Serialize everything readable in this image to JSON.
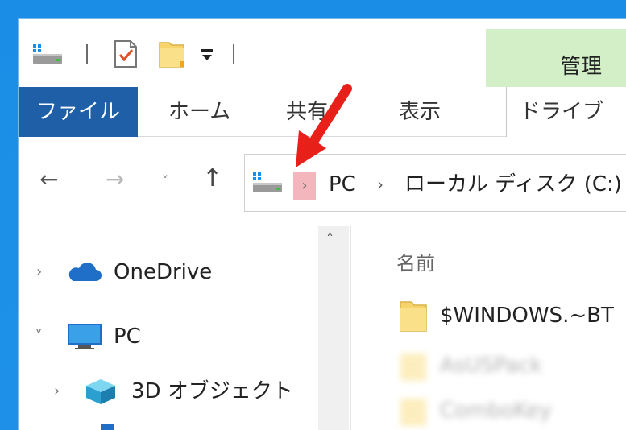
{
  "ribbon": {
    "tabs": {
      "file": "ファイル",
      "home": "ホーム",
      "share": "共有",
      "view": "表示",
      "drive_tools": "ドライブ ツー"
    },
    "contextual_group": "管理"
  },
  "quick_access": {
    "icons": [
      "drive-icon",
      "properties-icon",
      "new-folder-icon",
      "customize-dropdown-icon"
    ]
  },
  "address_bar": {
    "root_chevron": "›",
    "segments": [
      "PC",
      "ローカル ディスク (C:)"
    ],
    "separator": "›"
  },
  "nav_buttons": {
    "back": "←",
    "forward": "→",
    "recent": "˅",
    "up": "↑"
  },
  "nav_pane": {
    "items": [
      {
        "label": "OneDrive",
        "chevron": "›",
        "icon": "cloud-icon"
      },
      {
        "label": "PC",
        "chevron": "˅",
        "icon": "monitor-icon"
      },
      {
        "label": "3D オブジェクト",
        "chevron": "›",
        "icon": "cube-icon"
      }
    ],
    "scroll_up": "˄"
  },
  "file_list": {
    "column_header": "名前",
    "items": [
      {
        "name": "$WINDOWS.~BT"
      },
      {
        "name": "AsUSPack"
      },
      {
        "name": "ComboKey"
      }
    ]
  },
  "colors": {
    "file_tab": "#1f5fa8",
    "contextual_tab": "#d3efc8",
    "highlight": "#f4b6bd",
    "annotation_arrow": "#e8201a",
    "desktop": "#1a8ee6"
  }
}
